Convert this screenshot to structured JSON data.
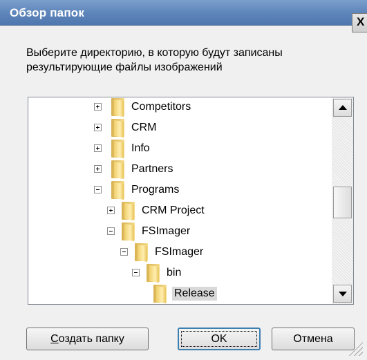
{
  "window": {
    "title": "Обзор папок",
    "close_label": "X"
  },
  "instruction": "Выберите директорию, в которую будут записаны результирующие файлы изображений",
  "tree": {
    "items": [
      {
        "label": "Competitors",
        "expander": "plus",
        "selected": false
      },
      {
        "label": "CRM",
        "expander": "plus",
        "selected": false
      },
      {
        "label": "Info",
        "expander": "plus",
        "selected": false
      },
      {
        "label": "Partners",
        "expander": "plus",
        "selected": false
      },
      {
        "label": "Programs",
        "expander": "minus",
        "selected": false
      },
      {
        "label": "CRM Project",
        "expander": "plus",
        "selected": false
      },
      {
        "label": "FSImager",
        "expander": "minus",
        "selected": false
      },
      {
        "label": "FSImager",
        "expander": "minus",
        "selected": false
      },
      {
        "label": "bin",
        "expander": "minus",
        "selected": false
      },
      {
        "label": "Release",
        "expander": "none",
        "selected": true
      }
    ]
  },
  "buttons": {
    "new_folder": {
      "mnemonic": "С",
      "rest": "оздать папку"
    },
    "ok": "OK",
    "cancel": "Отмена"
  },
  "colors": {
    "titlebar": "#5f86bb",
    "dialog_bg": "#f0f0f0",
    "selection_bg": "#d9d9d9",
    "default_button_border": "#3c7fb1"
  }
}
